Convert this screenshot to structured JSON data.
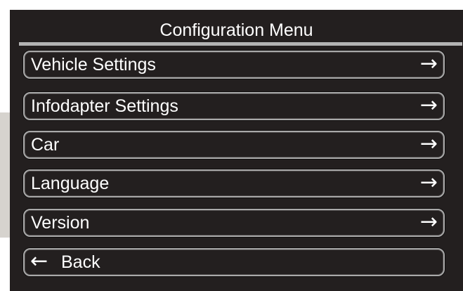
{
  "screen": {
    "title": "Configuration Menu"
  },
  "menu": {
    "items": [
      {
        "label": "Vehicle Settings",
        "icon": "arrow-right-icon",
        "glyph": "→"
      },
      {
        "label": "Infodapter Settings",
        "icon": "arrow-right-icon",
        "glyph": "→"
      },
      {
        "label": "Car",
        "icon": "arrow-right-icon",
        "glyph": "→"
      },
      {
        "label": "Language",
        "icon": "arrow-right-icon",
        "glyph": "→"
      },
      {
        "label": "Version",
        "icon": "arrow-right-icon",
        "glyph": "→"
      }
    ],
    "back": {
      "label": "Back",
      "icon": "arrow-left-icon",
      "glyph": "←"
    }
  },
  "colors": {
    "background": "#231f1f",
    "text": "#ffffff",
    "border": "#a9a9a9"
  }
}
